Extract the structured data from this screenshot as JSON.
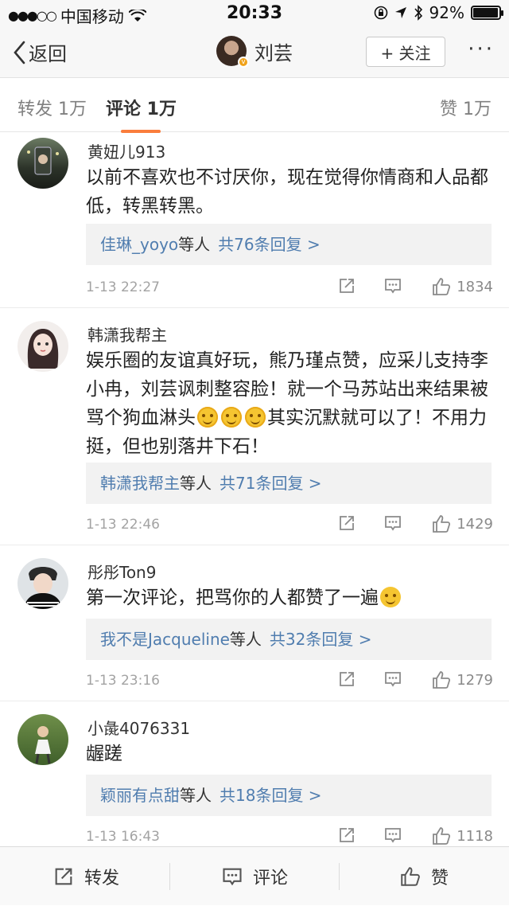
{
  "status_bar": {
    "signal": "●●●○○",
    "carrier": "中国移动",
    "time": "20:33",
    "battery": "92%"
  },
  "nav": {
    "back_label": "返回",
    "user_name": "刘芸",
    "follow_label": "+ 关注",
    "more_label": "···"
  },
  "tabs": {
    "repost": "转发 1万",
    "comment": "评论 1万",
    "like": "赞 1万"
  },
  "comments": [
    {
      "name": "黄妞儿913",
      "text": "以前不喜欢也不讨厌你，现在觉得你情商和人品都低，转黑转黑。",
      "replies_who": "佳琳_yoyo",
      "replies_etc": "等人",
      "replies_count": "共76条回复 >",
      "time": "1-13 22:27",
      "likes": "1834"
    },
    {
      "name": "韩潇我帮主",
      "text_a": "娱乐圈的友谊真好玩，熊乃瑾点赞，应采儿支持李小冉，刘芸讽刺整容脸！就一个马苏站出来结果被骂个狗血淋头",
      "text_b": "其实沉默就可以了！不用力挺，但也别落井下石！",
      "replies_who": "韩潇我帮主",
      "replies_etc": "等人",
      "replies_count": "共71条回复 >",
      "time": "1-13 22:46",
      "likes": "1429"
    },
    {
      "name": "彤彤Ton9",
      "text": "第一次评论，把骂你的人都赞了一遍",
      "replies_who": "我不是Jacqueline",
      "replies_etc": "等人",
      "replies_count": "共32条回复 >",
      "time": "1-13 23:16",
      "likes": "1279"
    },
    {
      "name": "小彘4076331",
      "text": "龌蹉",
      "replies_who": "颖丽有点甜",
      "replies_etc": "等人",
      "replies_count": "共18条回复 >",
      "time": "1-13 16:43",
      "likes": "1118"
    }
  ],
  "bottom_bar": {
    "repost": "转发",
    "comment": "评论",
    "like": "赞"
  }
}
